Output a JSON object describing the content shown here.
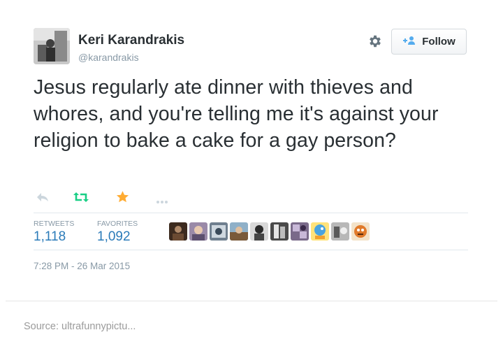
{
  "tweet": {
    "author": {
      "name": "Keri Karandrakis",
      "handle": "@karandrakis"
    },
    "follow_label": "Follow",
    "text": "Jesus regularly ate dinner with thieves and whores, and you're telling me it's against your religion to bake a cake for a gay person?",
    "actions": [
      "reply-icon",
      "retweet-icon",
      "favorite-icon",
      "more-icon"
    ],
    "stats": {
      "retweets_label": "RETWEETS",
      "retweets": "1,118",
      "favorites_label": "FAVORITES",
      "favorites": "1,092"
    },
    "timestamp": "7:28 PM - 26 Mar 2015"
  },
  "source": {
    "prefix": "Source:",
    "link": "ultrafunnypictu..."
  },
  "colors": {
    "text": "#292f33",
    "muted": "#8899a6",
    "link": "#2b7bb9",
    "retweet_green": "#19cf86",
    "favorite_gold": "#ffac33",
    "follow_blue": "#55acee"
  }
}
